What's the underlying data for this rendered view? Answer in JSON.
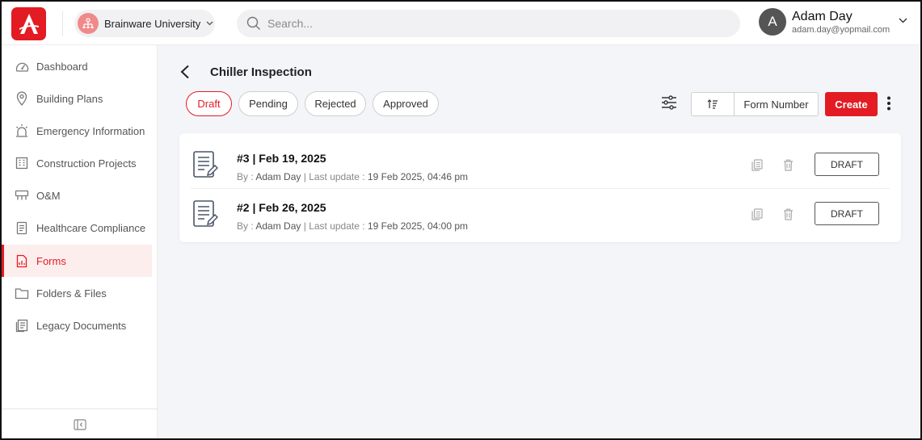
{
  "header": {
    "org_name": "Brainware University",
    "search_placeholder": "Search...",
    "user_initial": "A",
    "user_name": "Adam Day",
    "user_email": "adam.day@yopmail.com",
    "brand_color": "#e31b23"
  },
  "sidebar": {
    "items": [
      {
        "label": "Dashboard",
        "icon": "dashboard-icon"
      },
      {
        "label": "Building Plans",
        "icon": "location-pin-icon"
      },
      {
        "label": "Emergency Information",
        "icon": "siren-icon"
      },
      {
        "label": "Construction Projects",
        "icon": "building-icon"
      },
      {
        "label": "O&M",
        "icon": "maintenance-icon"
      },
      {
        "label": "Healthcare Compliance",
        "icon": "clipboard-icon"
      },
      {
        "label": "Forms",
        "icon": "form-icon",
        "active": true
      },
      {
        "label": "Folders & Files",
        "icon": "folder-icon"
      },
      {
        "label": "Legacy Documents",
        "icon": "documents-icon"
      }
    ]
  },
  "page": {
    "title": "Chiller Inspection",
    "tabs": [
      {
        "label": "Draft",
        "active": true
      },
      {
        "label": "Pending"
      },
      {
        "label": "Rejected"
      },
      {
        "label": "Approved"
      }
    ],
    "sort_field": "Form Number",
    "create_label": "Create"
  },
  "forms": [
    {
      "title": "#3 | Feb 19, 2025",
      "by_label": "By :",
      "author": "Adam Day",
      "separator": "|",
      "update_label": "Last update :",
      "updated": "19 Feb 2025, 04:46 pm",
      "status": "DRAFT"
    },
    {
      "title": "#2 | Feb 26, 2025",
      "by_label": "By :",
      "author": "Adam Day",
      "separator": "|",
      "update_label": "Last update :",
      "updated": "19 Feb 2025, 04:00 pm",
      "status": "DRAFT"
    }
  ]
}
